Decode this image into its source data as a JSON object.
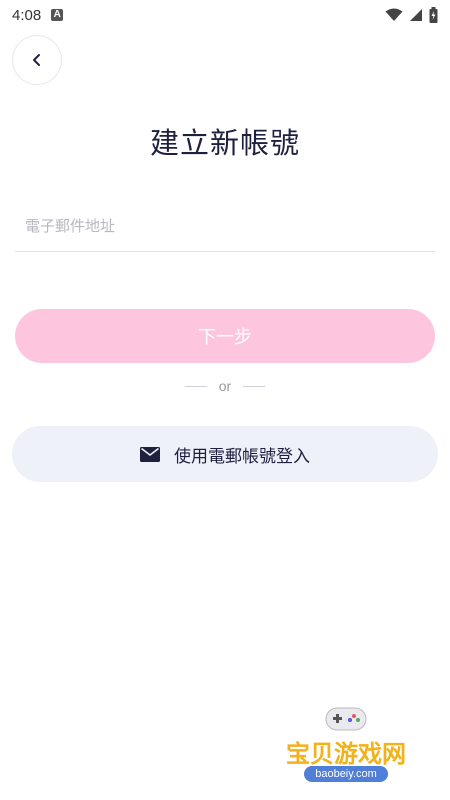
{
  "status_bar": {
    "time": "4:08",
    "notification": "A"
  },
  "title": "建立新帳號",
  "email_input": {
    "placeholder": "電子郵件地址",
    "value": ""
  },
  "next_button": {
    "label": "下一步"
  },
  "divider": {
    "text": "or"
  },
  "email_login_button": {
    "label": "使用電郵帳號登入"
  },
  "watermark": {
    "text": "宝贝游戏网",
    "url": "baobeiy.com"
  },
  "colors": {
    "primary_pink": "#fdc6de",
    "secondary_bg": "#eef1f8",
    "title_text": "#1f2040"
  },
  "icons": [
    "back-arrow-icon",
    "mail-icon",
    "wifi-icon",
    "battery-icon",
    "cell-signal-icon"
  ]
}
